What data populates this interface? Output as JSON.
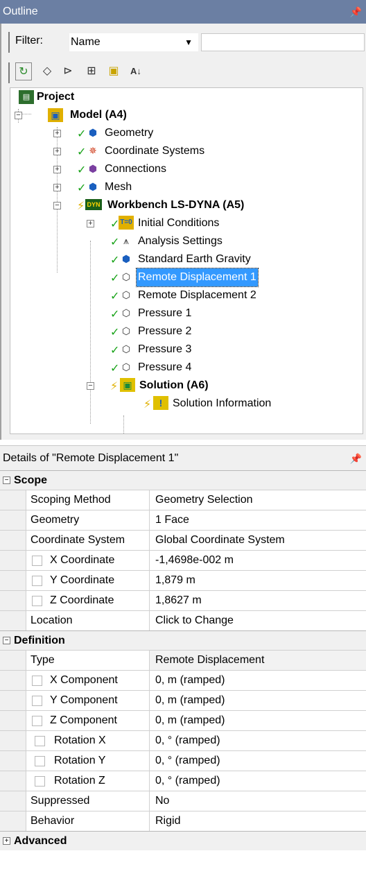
{
  "outline": {
    "title": "Outline",
    "pin_icon": "pin-icon",
    "filter_label": "Filter:",
    "filter_value": "Name",
    "toolbar_icons": [
      "refresh-icon",
      "hide-icon",
      "expand-icon",
      "plus-box-icon",
      "folder-icon",
      "sort-az-icon"
    ],
    "tree": {
      "project": "Project",
      "model": "Model (A4)",
      "geometry": "Geometry",
      "coordinate_systems": "Coordinate Systems",
      "connections": "Connections",
      "mesh": "Mesh",
      "workbench": "Workbench LS-DYNA (A5)",
      "initial_conditions": "Initial Conditions",
      "analysis_settings": "Analysis Settings",
      "gravity": "Standard Earth Gravity",
      "remote_disp_1": "Remote Displacement 1",
      "remote_disp_2": "Remote Displacement 2",
      "pressure_1": "Pressure 1",
      "pressure_2": "Pressure 2",
      "pressure_3": "Pressure 3",
      "pressure_4": "Pressure 4",
      "solution": "Solution (A6)",
      "solution_info": "Solution Information"
    }
  },
  "details": {
    "title": "Details of \"Remote Displacement 1\"",
    "scope": {
      "header": "Scope",
      "scoping_method": {
        "name": "Scoping Method",
        "value": "Geometry Selection"
      },
      "geometry": {
        "name": "Geometry",
        "value": "1 Face"
      },
      "coordinate_system": {
        "name": "Coordinate System",
        "value": "Global Coordinate System"
      },
      "x_coord": {
        "name": "X Coordinate",
        "value": "-1,4698e-002 m"
      },
      "y_coord": {
        "name": "Y Coordinate",
        "value": "1,879 m"
      },
      "z_coord": {
        "name": "Z Coordinate",
        "value": "1,8627 m"
      },
      "location": {
        "name": "Location",
        "value": "Click to Change"
      }
    },
    "definition": {
      "header": "Definition",
      "type": {
        "name": "Type",
        "value": "Remote Displacement"
      },
      "x_comp": {
        "name": "X Component",
        "value": "0, m  (ramped)"
      },
      "y_comp": {
        "name": "Y Component",
        "value": "0, m  (ramped)"
      },
      "z_comp": {
        "name": "Z Component",
        "value": "0, m  (ramped)"
      },
      "rot_x": {
        "name": "Rotation X",
        "value": "0, °  (ramped)"
      },
      "rot_y": {
        "name": "Rotation Y",
        "value": "0, °  (ramped)"
      },
      "rot_z": {
        "name": "Rotation Z",
        "value": "0, °  (ramped)"
      },
      "suppressed": {
        "name": "Suppressed",
        "value": "No"
      },
      "behavior": {
        "name": "Behavior",
        "value": "Rigid"
      }
    },
    "advanced": {
      "header": "Advanced"
    }
  },
  "colors": {
    "titlebar": "#6b7fa3",
    "selection": "#3399ff",
    "check": "#19a319",
    "bolt": "#e0b000"
  }
}
